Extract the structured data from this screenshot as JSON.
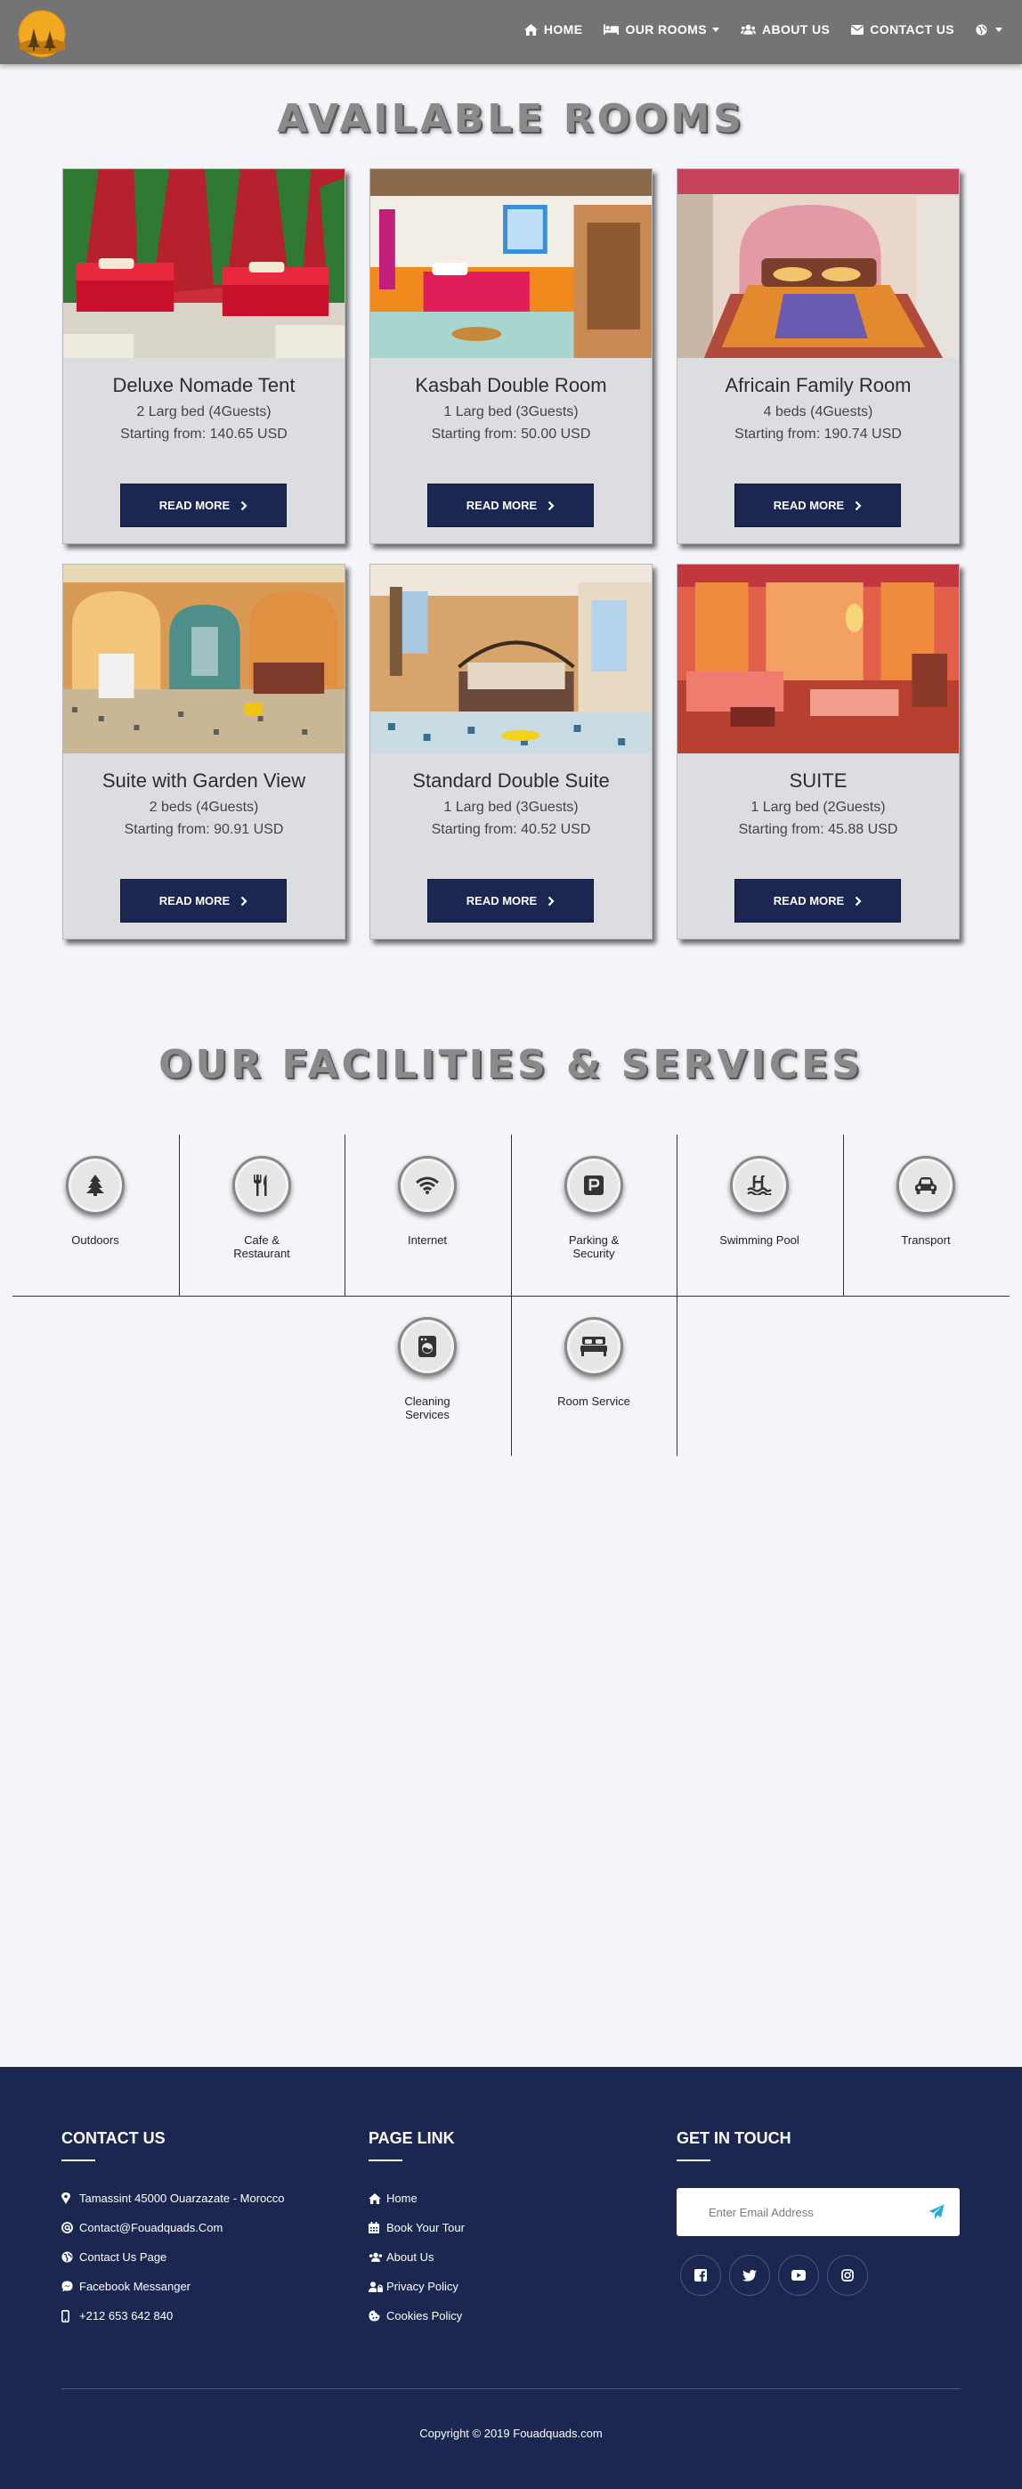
{
  "nav": {
    "items": [
      {
        "label": "HOME",
        "icon": "home-icon"
      },
      {
        "label": "OUR ROOMS",
        "icon": "bed-icon"
      },
      {
        "label": "ABOUT US",
        "icon": "users-icon"
      },
      {
        "label": "CONTACT US",
        "icon": "envelope-icon"
      }
    ],
    "language_icon": "globe-icon"
  },
  "rooms": {
    "title": "AVAILABLE ROOMS",
    "button_label": "READ MORE",
    "items": [
      {
        "name": "Deluxe Nomade Tent",
        "beds": "2 Larg bed (4Guests)",
        "price": "Starting from: 140.65 USD"
      },
      {
        "name": "Kasbah Double Room",
        "beds": "1 Larg bed (3Guests)",
        "price": "Starting from: 50.00 USD"
      },
      {
        "name": "Africain Family Room",
        "beds": "4 beds (4Guests)",
        "price": "Starting from: 190.74 USD"
      },
      {
        "name": "Suite with Garden View",
        "beds": "2 beds (4Guests)",
        "price": "Starting from: 90.91 USD"
      },
      {
        "name": "Standard Double Suite",
        "beds": "1 Larg bed (3Guests)",
        "price": "Starting from: 40.52 USD"
      },
      {
        "name": "SUITE",
        "beds": "1 Larg bed (2Guests)",
        "price": "Starting from: 45.88 USD"
      }
    ]
  },
  "facilities": {
    "title": "OUR FACILITIES & SERVICES",
    "items": [
      {
        "label": "Outdoors",
        "icon": "tree-icon"
      },
      {
        "label": "Cafe & Restaurant",
        "icon": "utensils-icon"
      },
      {
        "label": "Internet",
        "icon": "wifi-icon"
      },
      {
        "label": "Parking & Security",
        "icon": "parking-icon"
      },
      {
        "label": "Swimming Pool",
        "icon": "swimming-pool-icon"
      },
      {
        "label": "Transport",
        "icon": "car-icon"
      },
      {
        "label": "Cleaning Services",
        "icon": "washing-machine-icon"
      },
      {
        "label": "Room Service",
        "icon": "bed-icon"
      }
    ]
  },
  "footer": {
    "contact": {
      "heading": "CONTACT US",
      "items": [
        {
          "text": "Tamassint 45000 Ouarzazate - Morocco",
          "icon": "map-marker-icon"
        },
        {
          "text": "Contact@Fouadquads.Com",
          "icon": "at-icon"
        },
        {
          "text": "Contact Us Page",
          "icon": "globe-icon"
        },
        {
          "text": "Facebook Messanger",
          "icon": "messenger-icon"
        },
        {
          "text": "+212 653 642 840",
          "icon": "mobile-icon"
        }
      ]
    },
    "links": {
      "heading": "PAGE LINK",
      "items": [
        {
          "text": "Home",
          "icon": "home-icon"
        },
        {
          "text": "Book Your Tour",
          "icon": "calendar-icon"
        },
        {
          "text": "About Us",
          "icon": "users-icon"
        },
        {
          "text": "Privacy Policy",
          "icon": "user-lock-icon"
        },
        {
          "text": "Cookies Policy",
          "icon": "cookie-icon"
        }
      ]
    },
    "touch": {
      "heading": "GET IN TOUCH",
      "email_placeholder": "Enter Email Address",
      "send_icon": "paper-plane-icon",
      "socials": [
        "facebook-icon",
        "twitter-icon",
        "youtube-icon",
        "instagram-icon"
      ]
    },
    "copyright": "Copyright © 2019 Fouadquads.com"
  },
  "colors": {
    "navbar": "#747474",
    "page_background": "#f4f5f9",
    "card_background": "#dcdde1",
    "button_navy": "#1b2651",
    "footer_navy": "#1b2651",
    "send_icon": "#23b0d8",
    "logo_sun": "#f2a91f"
  }
}
